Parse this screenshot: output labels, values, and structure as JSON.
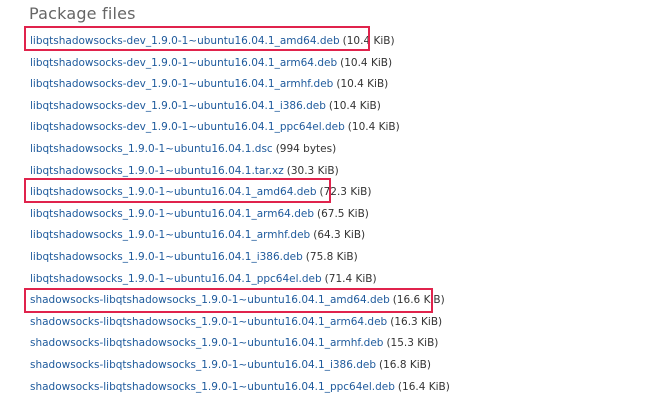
{
  "section": {
    "title": "Package files"
  },
  "files": [
    {
      "name": "libqtshadowsocks-dev_1.9.0-1~ubuntu16.04.1_amd64.deb",
      "size": "(10.4 KiB)",
      "highlighted": true
    },
    {
      "name": "libqtshadowsocks-dev_1.9.0-1~ubuntu16.04.1_arm64.deb",
      "size": "(10.4 KiB)",
      "highlighted": false
    },
    {
      "name": "libqtshadowsocks-dev_1.9.0-1~ubuntu16.04.1_armhf.deb",
      "size": "(10.4 KiB)",
      "highlighted": false
    },
    {
      "name": "libqtshadowsocks-dev_1.9.0-1~ubuntu16.04.1_i386.deb",
      "size": "(10.4 KiB)",
      "highlighted": false
    },
    {
      "name": "libqtshadowsocks-dev_1.9.0-1~ubuntu16.04.1_ppc64el.deb",
      "size": "(10.4 KiB)",
      "highlighted": false
    },
    {
      "name": "libqtshadowsocks_1.9.0-1~ubuntu16.04.1.dsc",
      "size": "(994 bytes)",
      "highlighted": false
    },
    {
      "name": "libqtshadowsocks_1.9.0-1~ubuntu16.04.1.tar.xz",
      "size": "(30.3 KiB)",
      "highlighted": false
    },
    {
      "name": "libqtshadowsocks_1.9.0-1~ubuntu16.04.1_amd64.deb",
      "size": "(72.3 KiB)",
      "highlighted": true
    },
    {
      "name": "libqtshadowsocks_1.9.0-1~ubuntu16.04.1_arm64.deb",
      "size": "(67.5 KiB)",
      "highlighted": false
    },
    {
      "name": "libqtshadowsocks_1.9.0-1~ubuntu16.04.1_armhf.deb",
      "size": "(64.3 KiB)",
      "highlighted": false
    },
    {
      "name": "libqtshadowsocks_1.9.0-1~ubuntu16.04.1_i386.deb",
      "size": "(75.8 KiB)",
      "highlighted": false
    },
    {
      "name": "libqtshadowsocks_1.9.0-1~ubuntu16.04.1_ppc64el.deb",
      "size": "(71.4 KiB)",
      "highlighted": false
    },
    {
      "name": "shadowsocks-libqtshadowsocks_1.9.0-1~ubuntu16.04.1_amd64.deb",
      "size": "(16.6 KiB)",
      "highlighted": true
    },
    {
      "name": "shadowsocks-libqtshadowsocks_1.9.0-1~ubuntu16.04.1_arm64.deb",
      "size": "(16.3 KiB)",
      "highlighted": false
    },
    {
      "name": "shadowsocks-libqtshadowsocks_1.9.0-1~ubuntu16.04.1_armhf.deb",
      "size": "(15.3 KiB)",
      "highlighted": false
    },
    {
      "name": "shadowsocks-libqtshadowsocks_1.9.0-1~ubuntu16.04.1_i386.deb",
      "size": "(16.8 KiB)",
      "highlighted": false
    },
    {
      "name": "shadowsocks-libqtshadowsocks_1.9.0-1~ubuntu16.04.1_ppc64el.deb",
      "size": "(16.4 KiB)",
      "highlighted": false
    }
  ],
  "colors": {
    "link": "#1e5a9c",
    "highlight_border": "#e0234c",
    "heading": "#666666"
  }
}
